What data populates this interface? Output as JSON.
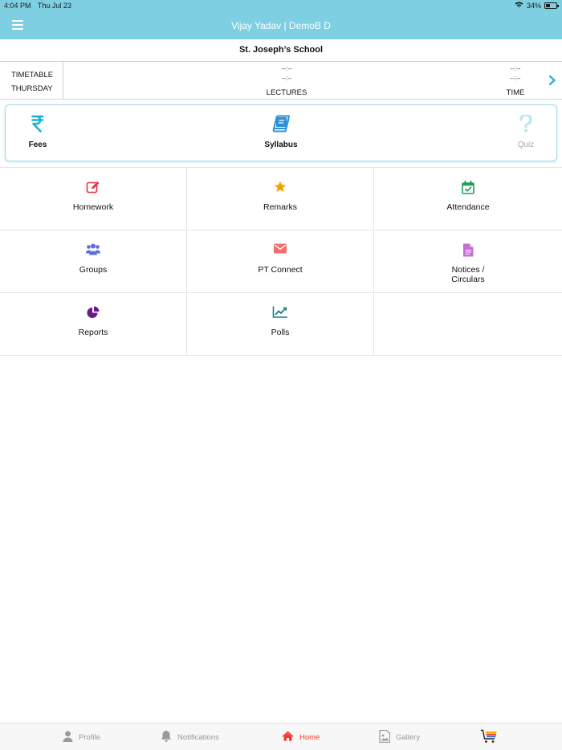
{
  "status_bar": {
    "time": "4:04 PM",
    "date": "Thu Jul 23",
    "battery": "34%"
  },
  "header": {
    "title": "Vijay Yadav | DemoB D"
  },
  "school": {
    "name": "St. Joseph’s School"
  },
  "timetable": {
    "label": "TIMETABLE",
    "day": "THURSDAY",
    "lectures_placeholder_1": "--:--",
    "lectures_placeholder_2": "--:--",
    "lectures_label": "LECTURES",
    "time_placeholder_1": "--:--",
    "time_placeholder_2": "--:--",
    "time_label": "TIME"
  },
  "quick_actions": [
    {
      "label": "Fees",
      "icon": "rupee-icon",
      "color": "#1ab3d6",
      "enabled": true
    },
    {
      "label": "Syllabus",
      "icon": "book-icon",
      "color": "#2f8fd9",
      "enabled": true
    },
    {
      "label": "Quiz",
      "icon": "question-icon",
      "color": "#b8e6f3",
      "enabled": false
    }
  ],
  "modules": [
    {
      "label": "Homework",
      "icon": "edit-icon",
      "color": "#e8304a"
    },
    {
      "label": "Remarks",
      "icon": "star-icon",
      "color": "#f5a200"
    },
    {
      "label": "Attendance",
      "icon": "calendar-check-icon",
      "color": "#1f9d5c"
    },
    {
      "label": "Groups",
      "icon": "users-icon",
      "color": "#5b6fd6"
    },
    {
      "label": "PT Connect",
      "icon": "envelope-icon",
      "color": "#f0706b"
    },
    {
      "label_line1": "Notices /",
      "label_line2": "Circulars",
      "icon": "document-icon",
      "color": "#c86ad8"
    },
    {
      "label": "Reports",
      "icon": "pie-chart-icon",
      "color": "#6a1a8a"
    },
    {
      "label": "Polls",
      "icon": "line-chart-icon",
      "color": "#1a7f86"
    }
  ],
  "tabbar": {
    "profile": "Profile",
    "notifications": "Notifications",
    "home": "Home",
    "gallery": "Gallery"
  },
  "colors": {
    "header": "#7ecfe2",
    "active_tab": "#ef3b2d",
    "inactive_tab": "#9a9a9a"
  }
}
